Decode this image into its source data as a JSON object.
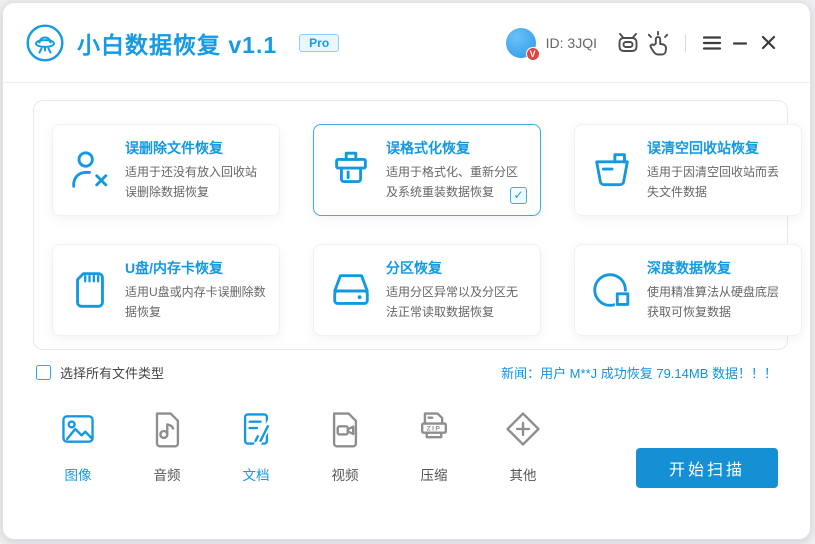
{
  "titlebar": {
    "app_title": "小白数据恢复",
    "version": "v1.1",
    "pro_badge": "Pro",
    "user_id": "ID: 3JQI"
  },
  "cards": [
    {
      "icon": "user-x-icon",
      "title": "误删除文件恢复",
      "desc": "适用于还没有放入回收站误删除数据恢复",
      "selected": false
    },
    {
      "icon": "format-brush-icon",
      "title": "误格式化恢复",
      "desc": "适用于格式化、重新分区及系统重装数据恢复",
      "selected": true,
      "checked": true,
      "check_glyph": "✓"
    },
    {
      "icon": "recycle-bin-icon",
      "title": "误清空回收站恢复",
      "desc": "适用于因清空回收站而丢失文件数据",
      "selected": false
    },
    {
      "icon": "sd-card-icon",
      "title": "U盘/内存卡恢复",
      "desc": "适用U盘或内存卡误删除数据恢复",
      "selected": false
    },
    {
      "icon": "hard-drive-icon",
      "title": "分区恢复",
      "desc": "适用分区异常以及分区无法正常读取数据恢复",
      "selected": false
    },
    {
      "icon": "deep-scan-icon",
      "title": "深度数据恢复",
      "desc": "使用精准算法从硬盘底层获取可恢复数据",
      "selected": false
    }
  ],
  "options": {
    "select_all_label": "选择所有文件类型",
    "select_all_checked": false,
    "news": "新闻：用户 M**J 成功恢复 79.14MB 数据！！！"
  },
  "filetypes": [
    {
      "label": "图像",
      "active": true
    },
    {
      "label": "音频",
      "active": false
    },
    {
      "label": "文档",
      "active": true
    },
    {
      "label": "视频",
      "active": false
    },
    {
      "label": "压缩",
      "active": false,
      "badge": "ZIP"
    },
    {
      "label": "其他",
      "active": false
    }
  ],
  "actions": {
    "scan_button": "开始扫描"
  },
  "colors": {
    "primary": "#1499e0",
    "button": "#1590d5",
    "news": "#1392dc",
    "badge_red": "#e64340"
  }
}
